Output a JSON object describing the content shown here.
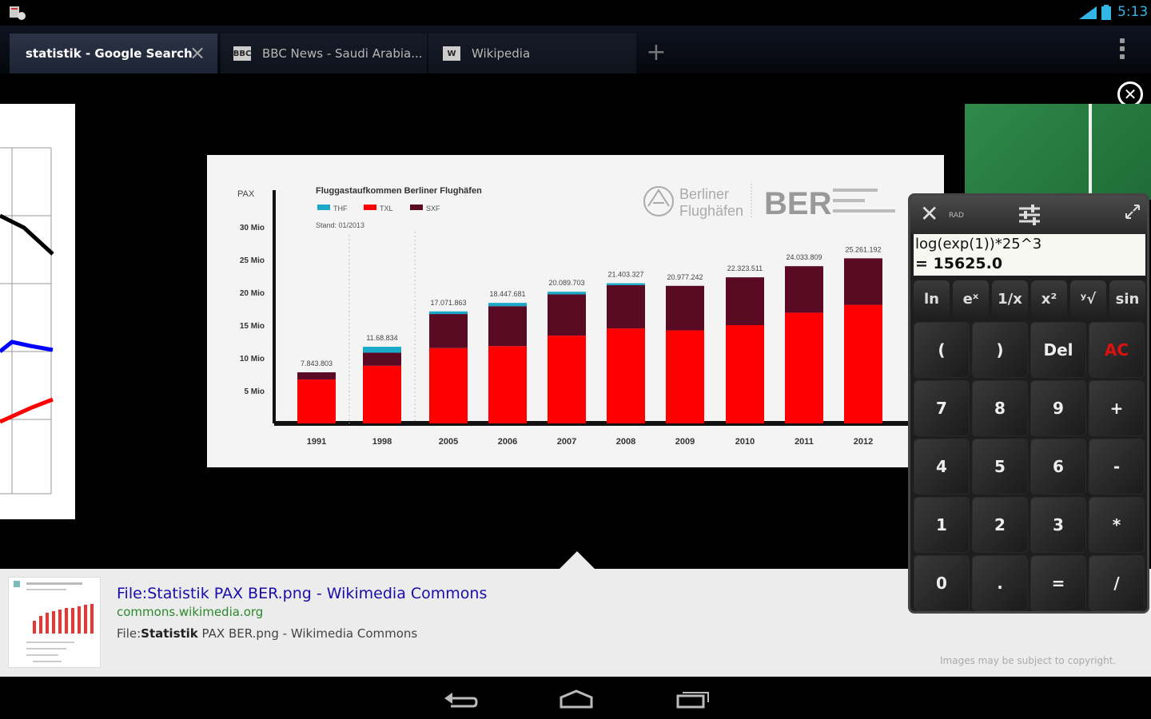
{
  "status": {
    "time": "5:13"
  },
  "tabs": [
    {
      "label": "statistik - Google Search",
      "active": true
    },
    {
      "label": "BBC News - Saudi Arabia...",
      "favicon": "BBC"
    },
    {
      "label": "Wikipedia",
      "favicon": "W"
    }
  ],
  "chart_data": {
    "type": "bar",
    "title": "Fluggastaufkommen Berliner Flughäfen",
    "stand": "Stand: 01/2013",
    "ylabel": "PAX",
    "y_ticks": [
      "30 Mio",
      "25 Mio",
      "20 Mio",
      "15 Mio",
      "10 Mio",
      "5 Mio"
    ],
    "ylim": [
      0,
      30000000
    ],
    "categories": [
      "1991",
      "1998",
      "2005",
      "2006",
      "2007",
      "2008",
      "2009",
      "2010",
      "2011",
      "2012"
    ],
    "totals_labels": [
      "7.843.803",
      "11.68.834",
      "17.071.863",
      "18.447.681",
      "20.089.703",
      "21.403.327",
      "20.977.242",
      "22.323.511",
      "24.033.809",
      "25.261.192"
    ],
    "series": [
      {
        "name": "THF",
        "color": "#1aa9c9",
        "values": [
          0,
          900000,
          400000,
          500000,
          400000,
          300000,
          0,
          0,
          0,
          0
        ]
      },
      {
        "name": "TXL",
        "color": "#ff0000",
        "values": [
          6700000,
          8800000,
          11500000,
          11800000,
          13400000,
          14500000,
          14200000,
          15000000,
          16900000,
          18100000
        ]
      },
      {
        "name": "SXF",
        "color": "#5a0a22",
        "values": [
          1100000,
          2000000,
          5200000,
          6100000,
          6300000,
          6600000,
          6800000,
          7300000,
          7100000,
          7100000
        ]
      }
    ],
    "legend": [
      "THF",
      "TXL",
      "SXF"
    ],
    "brand1": "Berliner",
    "brand2": "Flughäfen",
    "brand3": "BER"
  },
  "calculator": {
    "rad": "RAD",
    "expression": "log(exp(1))*25^3",
    "result": "= 15625.0",
    "fn_keys": [
      "ln",
      "eˣ",
      "1/x",
      "x²",
      "ʸ√",
      "sin"
    ],
    "keys": [
      "(",
      ")",
      "Del",
      "AC",
      "7",
      "8",
      "9",
      "+",
      "4",
      "5",
      "6",
      "-",
      "1",
      "2",
      "3",
      "*",
      "0",
      ".",
      "=",
      "/"
    ]
  },
  "result": {
    "title": "File:Statistik PAX BER.png - Wikimedia Commons",
    "url": "commons.wikimedia.org",
    "desc_prefix": "File:",
    "desc_bold": "Statistik",
    "desc_suffix": " PAX BER.png - Wikimedia Commons",
    "copyright": "Images may be subject to copyright."
  }
}
